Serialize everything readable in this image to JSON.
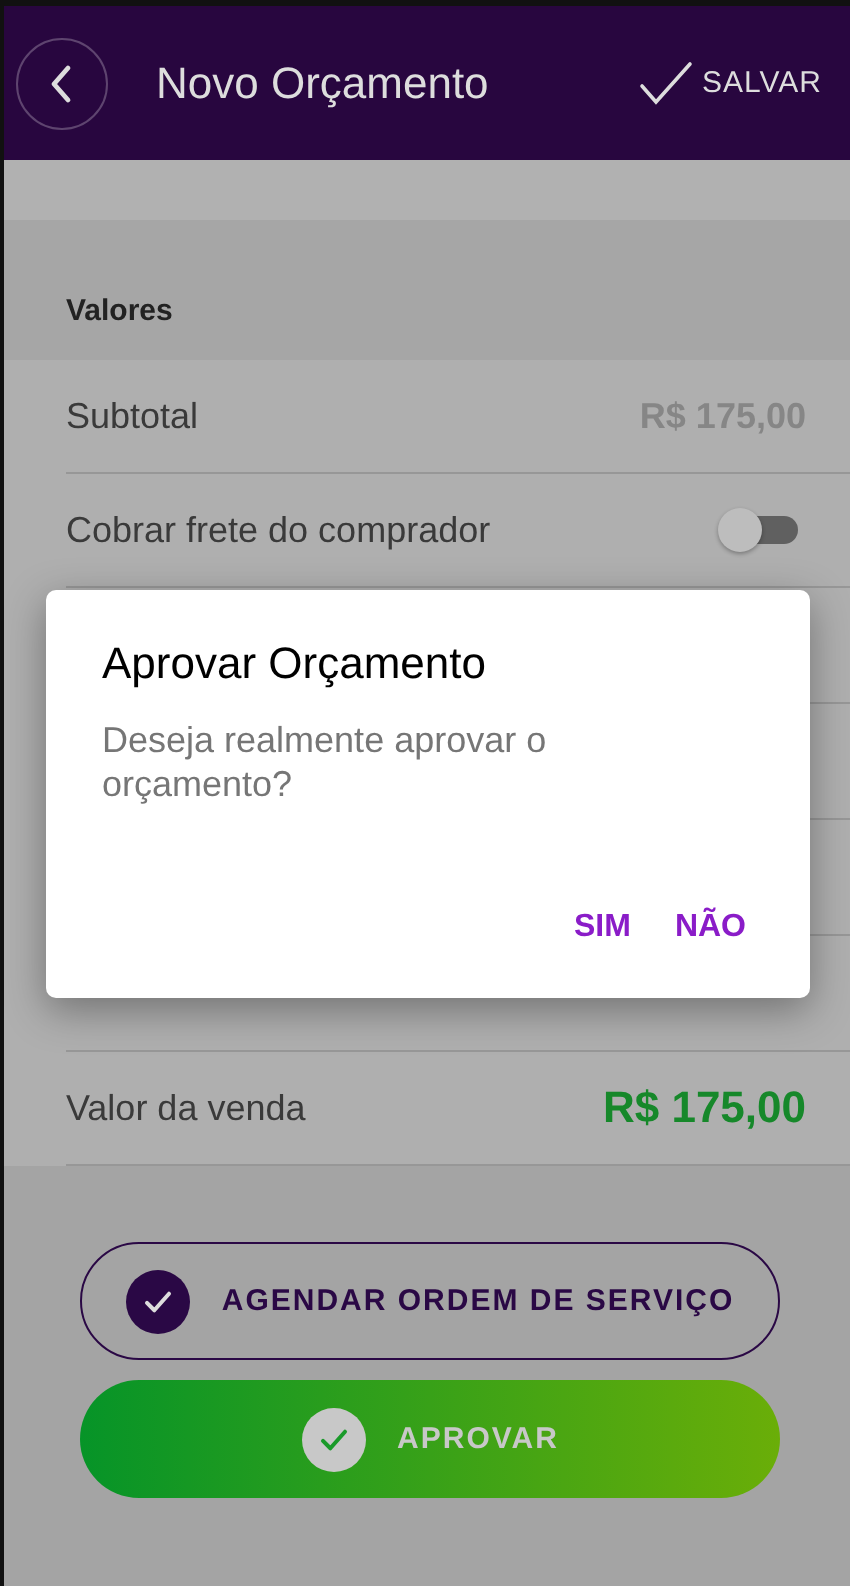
{
  "header": {
    "title": "Novo Orçamento",
    "save_label": "SALVAR"
  },
  "section": {
    "title": "Valores"
  },
  "rows": [
    {
      "kind": "value",
      "label": "Subtotal",
      "value": "R$ 175,00"
    },
    {
      "kind": "toggle",
      "label": "Cobrar frete do comprador",
      "checked": false
    },
    {
      "kind": "total",
      "label": "Valor da venda",
      "value": "R$ 175,00"
    }
  ],
  "actions": [
    {
      "kind": "outline",
      "label": "AGENDAR ORDEM DE SERVIÇO"
    },
    {
      "kind": "filled",
      "label": "APROVAR"
    }
  ],
  "dialog": {
    "title": "Aprovar Orçamento",
    "message": "Deseja realmente aprovar o orçamento?",
    "buttons": [
      "SIM",
      "NÃO"
    ]
  }
}
